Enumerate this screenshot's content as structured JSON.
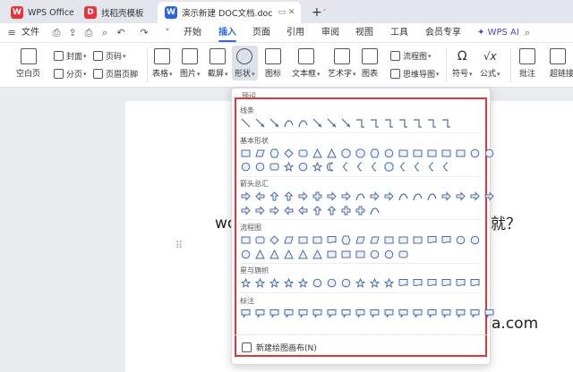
{
  "tabs": [
    {
      "label": "WPS Office",
      "icon": "wps-logo",
      "color": "#e5343a"
    },
    {
      "label": "找稻壳模板",
      "icon": "docer-logo",
      "color": "#e5343a"
    },
    {
      "label": "演示新建 DOC文档.doc",
      "icon": "writer-logo",
      "color": "#2f65d8"
    }
  ],
  "tab_new": "+",
  "menubar": {
    "file": "文件",
    "items": [
      "开始",
      "插入",
      "页面",
      "引用",
      "审阅",
      "视图",
      "工具",
      "会员专享"
    ],
    "selected": "插入",
    "wps_ai": "WPS AI"
  },
  "ribbon": {
    "blank_page": "空白页",
    "cover": "封面",
    "page_num": "页码",
    "section": "分页",
    "header_footer": "页眉页脚",
    "table": "表格",
    "picture": "图片",
    "screenshot": "截屏",
    "shape": "形状",
    "icons": "图标",
    "textbox": "文本框",
    "wordart": "艺术字",
    "chart": "图表",
    "flowchart": "流程图",
    "mindmap": "思维导图",
    "symbol": "符号",
    "formula": "公式",
    "comment": "批注",
    "hyperlink": "超链接"
  },
  "doc": {
    "text1": "wo",
    "text2": "就？",
    "text3": "a.com"
  },
  "dropdown": {
    "header": "预设",
    "sections": [
      "线条",
      "基本形状",
      "箭头总汇",
      "流程图",
      "星与旗帜",
      "标注"
    ],
    "footer": "新建绘图画布(N)"
  },
  "accent": "#2a6ae8",
  "highlight": "#e0363b"
}
